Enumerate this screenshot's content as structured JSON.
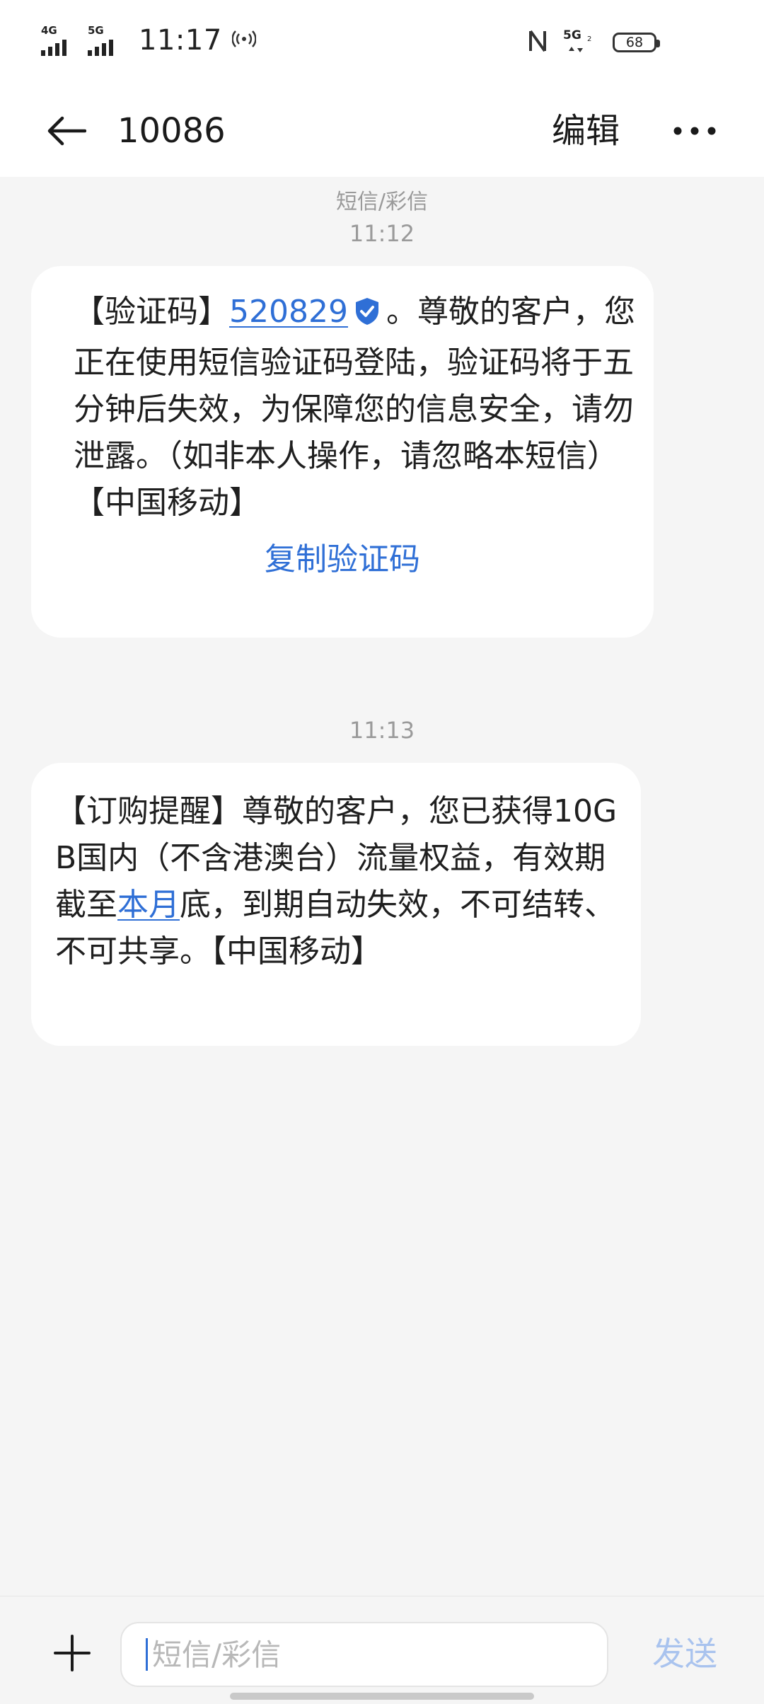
{
  "status_bar": {
    "network_1": "4G",
    "network_2": "5G",
    "time": "11:17",
    "network_type": "5G",
    "network_sub": "2",
    "battery_level": "68"
  },
  "header": {
    "title": "10086",
    "edit_label": "编辑"
  },
  "thread": {
    "service_label": "短信/彩信",
    "messages": [
      {
        "time": "11:12",
        "text_before": "【验证码】",
        "code": "520829",
        "text_after": "。尊敬的客户，您正在使用短信验证码登陆，验证码将于五分钟后失效，为保障您的信息安全，请勿泄露。（如非本人操作，请忽略本短信）【中国移动】",
        "copy_label": "复制验证码"
      },
      {
        "time": "11:13",
        "text_before": "【订购提醒】尊敬的客户，您已获得10GB国内（不含港澳台）流量权益，有效期截至",
        "link": "本月",
        "text_after": "底，到期自动失效，不可结转、不可共享。【中国移动】"
      }
    ]
  },
  "composer": {
    "placeholder": "短信/彩信",
    "send_label": "发送"
  },
  "colors": {
    "accent": "#2f6fd6",
    "send_disabled": "#a9c3ee",
    "background": "#f5f5f5"
  },
  "icons": {
    "back": "arrow-left-icon",
    "more": "more-horizontal-icon",
    "verified": "shield-check-icon",
    "add": "plus-icon",
    "nfc": "nfc-icon",
    "hotspot": "hotspot-icon"
  }
}
